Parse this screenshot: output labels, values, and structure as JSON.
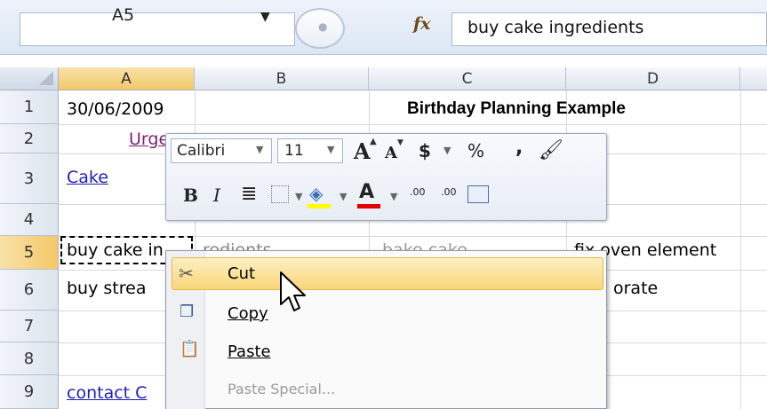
{
  "formula_bar": {
    "name_box": "A5",
    "fx_label": "fx",
    "formula": "buy cake ingredients"
  },
  "columns": [
    "A",
    "B",
    "C",
    "D"
  ],
  "rows": [
    "1",
    "2",
    "3",
    "4",
    "5",
    "6",
    "7",
    "8",
    "9"
  ],
  "cells": {
    "A1": "30/06/2009",
    "C1": "Birthday Planning Example",
    "A2": "Urge",
    "A3": "Cake",
    "A5": "buy cake in",
    "B5": "redients",
    "C5": "bake cake",
    "D5": "fix oven element",
    "A6": "buy strea",
    "D6": "orate",
    "A9": "contact C"
  },
  "mini_toolbar": {
    "font": "Calibri",
    "size": "11",
    "grow_font": "A",
    "shrink_font": "A",
    "currency": "$",
    "percent": "%",
    "comma": ",",
    "bold": "B",
    "italic": "I",
    "font_color": "A",
    "inc_decimal": ".00",
    "dec_decimal": ".00"
  },
  "context_menu": {
    "items": [
      {
        "label": "Cut",
        "icon": "scissors-icon",
        "highlighted": true,
        "enabled": true
      },
      {
        "label": "Copy",
        "icon": "copy-icon",
        "enabled": true
      },
      {
        "label": "Paste",
        "icon": "paste-icon",
        "enabled": true
      },
      {
        "label": "Paste Special...",
        "icon": "",
        "enabled": false
      }
    ]
  },
  "colors": {
    "selection_header": "#f3c869",
    "menu_highlight": "#f9d678",
    "link": "#1f1fb3"
  }
}
